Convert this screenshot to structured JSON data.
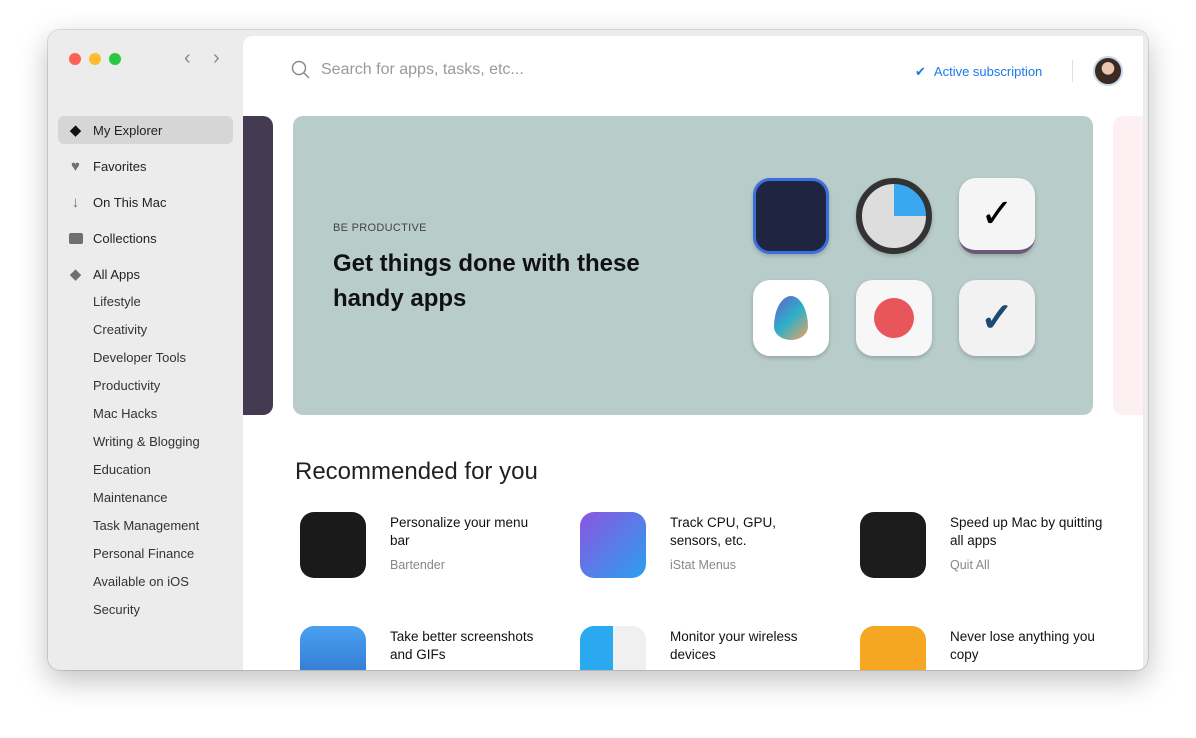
{
  "sidebar": {
    "items": [
      {
        "label": "My Explorer",
        "icon": "explorer-icon"
      },
      {
        "label": "Favorites",
        "icon": "heart-icon"
      },
      {
        "label": "On This Mac",
        "icon": "download-arrow-icon"
      },
      {
        "label": "Collections",
        "icon": "folder-icon"
      },
      {
        "label": "All Apps",
        "icon": "diamond-icon"
      }
    ],
    "categories": [
      "Lifestyle",
      "Creativity",
      "Developer Tools",
      "Productivity",
      "Mac Hacks",
      "Writing & Blogging",
      "Education",
      "Maintenance",
      "Task Management",
      "Personal Finance",
      "Available on iOS",
      "Security"
    ]
  },
  "header": {
    "search_placeholder": "Search for apps, tasks, etc...",
    "subscription": "Active subscription"
  },
  "banner": {
    "eyebrow": "BE PRODUCTIVE",
    "title": "Get things done with these handy apps",
    "bg": "#b8ccc9"
  },
  "recommended": {
    "title": "Recommended for you",
    "apps": [
      {
        "tagline": "Personalize your menu bar",
        "name": "Bartender"
      },
      {
        "tagline": "Track CPU, GPU, sensors, etc.",
        "name": "iStat Menus"
      },
      {
        "tagline": "Speed up Mac by quitting all apps",
        "name": "Quit All"
      },
      {
        "tagline": "Take better screenshots and GIFs",
        "name": ""
      },
      {
        "tagline": "Monitor your wireless devices",
        "name": ""
      },
      {
        "tagline": "Never lose anything you copy",
        "name": ""
      }
    ]
  }
}
